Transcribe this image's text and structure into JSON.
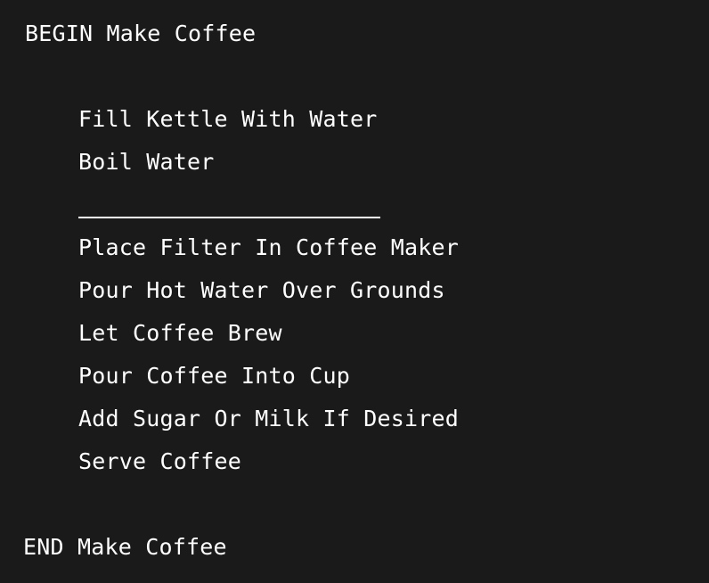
{
  "program": {
    "begin": "BEGIN Make Coffee",
    "steps": [
      "Fill Kettle With Water",
      "Boil Water",
      "",
      "Place Filter In Coffee Maker",
      "Pour Hot Water Over Grounds",
      "Let Coffee Brew",
      "Pour Coffee Into Cup",
      "Add Sugar Or Milk If Desired",
      "Serve Coffee"
    ],
    "end": "END Make Coffee"
  },
  "colors": {
    "background": "#1a1a1a",
    "text": "#ffffff"
  }
}
